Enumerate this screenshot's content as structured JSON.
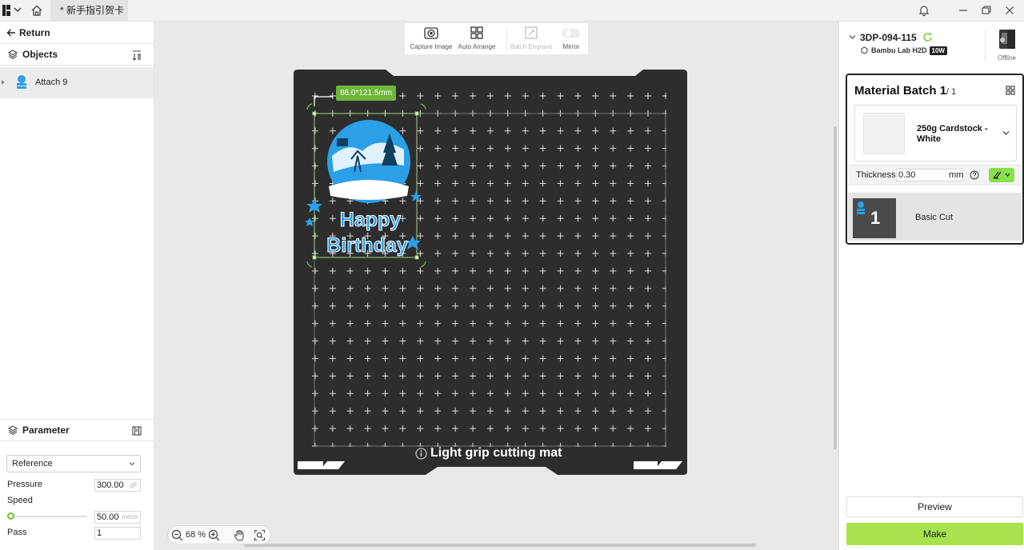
{
  "titlebar": {
    "tab_title": "* 新手指引贺卡"
  },
  "left_panel": {
    "return_label": "Return",
    "objects_label": "Objects",
    "objects": [
      {
        "name": "Attach 9"
      }
    ],
    "parameter_label": "Parameter",
    "preset_selected": "Reference",
    "params": {
      "pressure_label": "Pressure",
      "pressure_value": "300.00",
      "pressure_unit": "gF",
      "speed_label": "Speed",
      "speed_value": "50.00",
      "speed_unit": "mm/s",
      "pass_label": "Pass",
      "pass_value": "1"
    }
  },
  "toolbar": {
    "capture_label": "Capture Image",
    "arrange_label": "Auto Arrange",
    "batch_engrave_label": "Batch Engrave",
    "mirror_label": "Mirror"
  },
  "canvas": {
    "dimension_label": "86.0*121.5mm",
    "mat_label": "Light grip cutting mat",
    "design_text_line1": "Happy",
    "design_text_line2": "Birthday",
    "zoom_value": "68 %",
    "accent_color": "#2b9fe8",
    "dim_badge_color": "#6fb63a"
  },
  "right_panel": {
    "device_name": "3DP-094-115",
    "device_model": "Bambu Lab H2D",
    "device_power": "10W",
    "device_status": "Offline",
    "batch_title": "Material Batch 1",
    "batch_total": "/ 1",
    "material_name": "250g Cardstock - White",
    "thickness_label": "Thickness:",
    "thickness_value": "0.30",
    "thickness_unit": "mm",
    "cut_number": "1",
    "cut_name": "Basic Cut",
    "preview_label": "Preview",
    "make_label": "Make",
    "make_color": "#a6e34f"
  }
}
